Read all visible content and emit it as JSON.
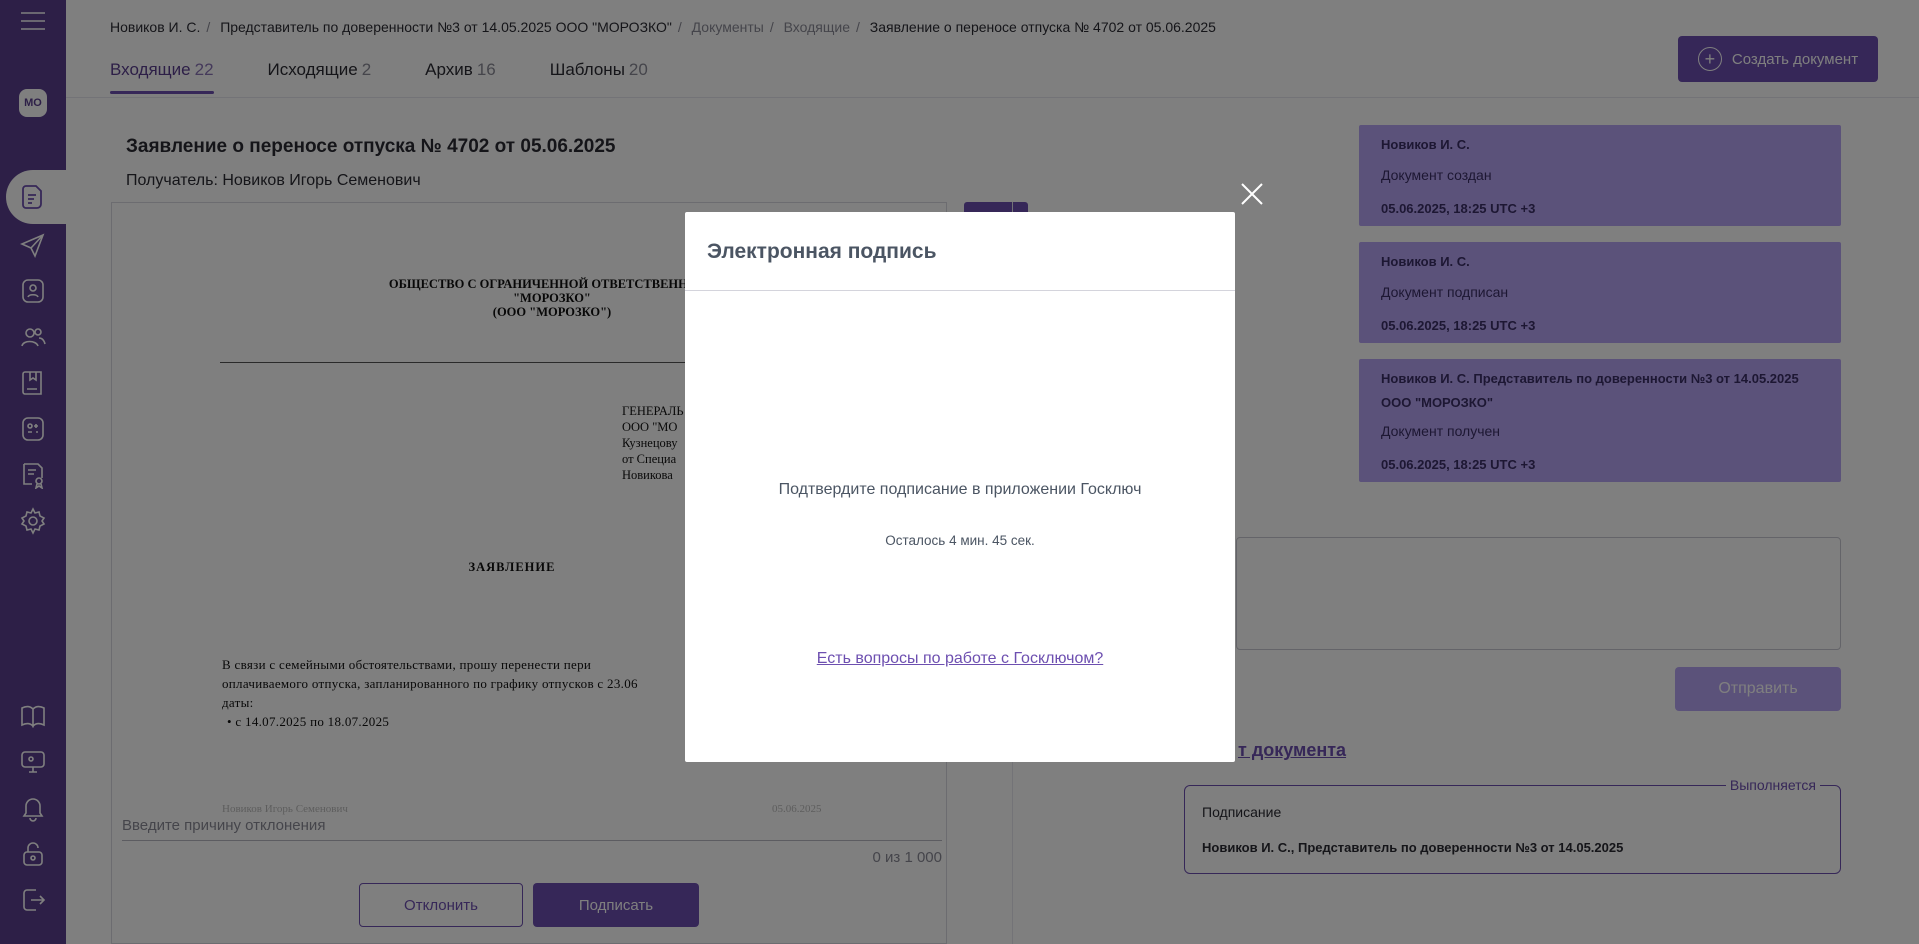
{
  "sidebar": {
    "avatar_initials": "МО",
    "icons": [
      "menu-icon",
      "documents-icon",
      "send-icon",
      "profile-icon",
      "users-icon",
      "book-icon",
      "apps-icon",
      "certificate-icon",
      "gear-icon",
      "help-book-icon",
      "monitor-icon",
      "bell-icon",
      "lock-icon",
      "logout-icon"
    ]
  },
  "breadcrumb": {
    "items": [
      "Новиков И. С.",
      "Представитель по доверенности №3 от 14.05.2025 ООО \"МОРОЗКО\"",
      "Документы",
      "Входящие",
      "Заявление о переносе отпуска № 4702 от 05.06.2025"
    ]
  },
  "tabs": [
    {
      "label": "Входящие",
      "count": "22"
    },
    {
      "label": "Исходящие",
      "count": "2"
    },
    {
      "label": "Архив",
      "count": "16"
    },
    {
      "label": "Шаблоны",
      "count": "20"
    }
  ],
  "create_button": "Создать документ",
  "document": {
    "title": "Заявление о переносе отпуска № 4702 от 05.06.2025",
    "recipient": "Получатель: Новиков Игорь Семенович",
    "org_lines": [
      "ОБЩЕСТВО С ОГРАНИЧЕННОЙ ОТВЕТСТВЕННОСТ",
      "\"МОРОЗКО\"",
      "(ООО \"МОРОЗКО\")"
    ],
    "addr_lines": [
      "ГЕНЕРАЛЬ",
      "ООО \"МО",
      "Кузнецову",
      "от Специа",
      "Новикова"
    ],
    "heading": "ЗАЯВЛЕНИЕ",
    "body_lines": [
      "В связи с семейными обстоятельствами, прошу перенести пери",
      "оплачиваемого отпуска, запланированного по графику отпусков с 23.06",
      "даты:"
    ],
    "bullet": "с 14.07.2025 по 18.07.2025",
    "faint_name": "Новиков Игорь Семенович",
    "faint_date": "05.06.2025"
  },
  "reject_reason_placeholder": "Введите причину отклонения",
  "char_counter": "0 из 1 000",
  "reject_button": "Отклонить",
  "sign_button": "Подписать",
  "history": [
    {
      "name": "Новиков И. С.",
      "action": "Документ создан",
      "time": "05.06.2025, 18:25 UTC +3"
    },
    {
      "name": "Новиков И. С.",
      "action": "Документ подписан",
      "time": "05.06.2025, 18:25 UTC +3"
    },
    {
      "name": "Новиков И. С. Представитель по доверенности №3 от 14.05.2025",
      "name2": "ООО \"МОРОЗКО\"",
      "action": "Документ получен",
      "time": "05.06.2025, 18:25 UTC +3"
    }
  ],
  "send_button": "Отправить",
  "route_link": "т документа",
  "status": {
    "label": "Выполняется",
    "step": "Подписание",
    "who": "Новиков И. С., Представитель по доверенности №3 от 14.05.2025"
  },
  "modal": {
    "title": "Электронная подпись",
    "message": "Подтвердите подписание в приложении Госключ",
    "timer": "Осталось 4 мин. 45 сек.",
    "help_link": "Есть вопросы по работе с Госключом?"
  },
  "colors": {
    "sidebar": "#5b3f8f",
    "accent": "#6d4fb0",
    "history_card": "#b7a5f5",
    "overlay": "rgba(0,0,0,0.5)"
  }
}
